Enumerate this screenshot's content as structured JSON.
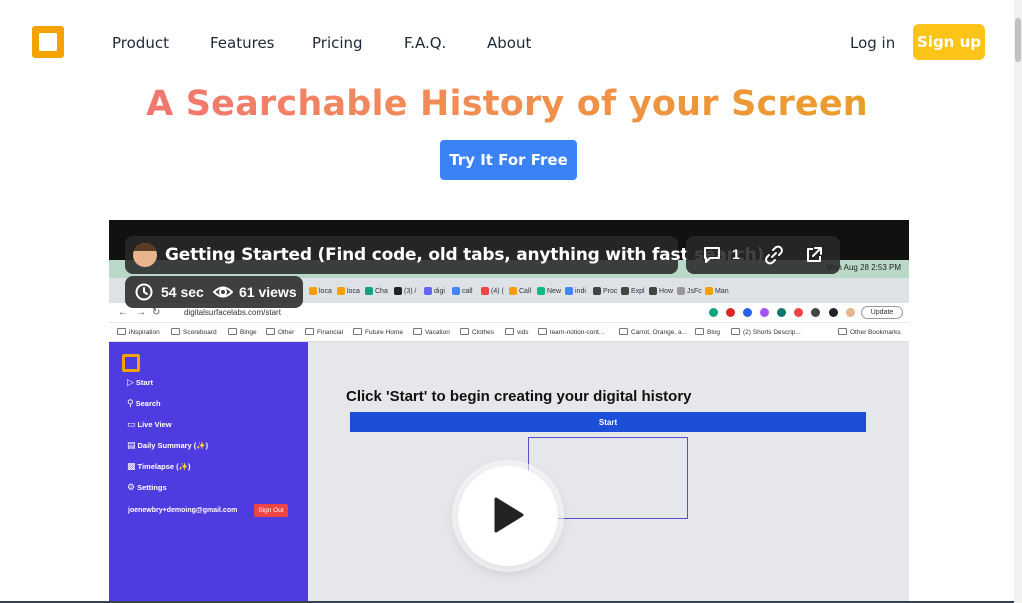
{
  "nav": {
    "links": [
      "Product",
      "Features",
      "Pricing",
      "F.A.Q.",
      "About"
    ],
    "login": "Log in",
    "signup": "Sign up",
    "logo_color": "#f5a300"
  },
  "hero": {
    "headline": "A Searchable History of your Screen",
    "cta": "Try It For Free",
    "cta_color": "#3b82f6"
  },
  "video": {
    "title": "Getting Started (Find code, old tabs, anything with fast search)",
    "comments": "1",
    "duration": "54 sec",
    "views": "61 views",
    "screen": {
      "menubar_time": "Mon Aug 28  2:53 PM",
      "url": "digitalsurfacelabs.com/start",
      "update_label": "Update",
      "tabs": [
        "loca",
        "loca",
        "Cha",
        "(3) /",
        "digi",
        "call",
        "(4) (",
        "Call",
        "New",
        "indi",
        "Proc",
        "Expl",
        "How",
        "JsFc",
        "Man"
      ],
      "bookmarks": [
        "iNspiration",
        "Scoreboard",
        "Binge",
        "Other",
        "Financial",
        "Future Home",
        "Vacation",
        "Clothes",
        "vids",
        "learn-notion-cont...",
        "Carrot, Orange, a...",
        "Blog",
        "(2) Shorts Descrip...",
        "Other Bookmarks"
      ],
      "sidebar": {
        "items": [
          "Start",
          "Search",
          "Live View",
          "Daily Summary (✨)",
          "Timelapse (✨)",
          "Settings"
        ],
        "email": "joenewbry+demoing@gmail.com",
        "signout": "Sign Out"
      },
      "main_title": "Click 'Start' to begin creating your digital history",
      "start_button": "Start"
    }
  }
}
